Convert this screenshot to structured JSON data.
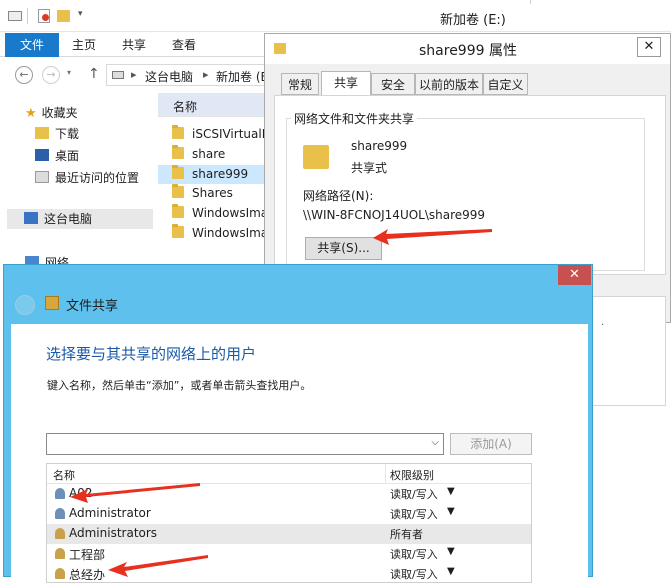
{
  "explorer": {
    "window_title": "新加卷 (E:)",
    "ribbon_tabs": [
      "文件",
      "主页",
      "共享",
      "查看"
    ],
    "breadcrumb": [
      "这台电脑",
      "新加卷 (E"
    ],
    "nav": {
      "favorites": "收藏夹",
      "downloads": "下载",
      "desktop": "桌面",
      "recent": "最近访问的位置",
      "this_pc": "这台电脑",
      "network": "网络"
    },
    "column_name": "名称",
    "files": [
      "iSCSIVirtualD",
      "share",
      "share999",
      "Shares",
      "WindowsIma",
      "WindowsIma"
    ]
  },
  "properties": {
    "title": "share999 属性",
    "tabs": [
      "常规",
      "共享",
      "安全",
      "以前的版本",
      "自定义"
    ],
    "group_title": "网络文件和文件夹共享",
    "folder_name": "share999",
    "folder_state": "共享式",
    "path_label": "网络路径(N):",
    "path_value": "\\\\WIN-8FCNOJ14UOL\\share999",
    "share_button": "共享(S)..."
  },
  "wizard": {
    "title": "文件共享",
    "heading": "选择要与其共享的网络上的用户",
    "instruction": "键入名称，然后单击“添加”，或者单击箭头查找用户。",
    "input_value": "",
    "add_button": "添加(A)",
    "col_name": "名称",
    "col_level": "权限级别",
    "users": [
      {
        "name": "A02",
        "level": "读取/写入",
        "dropdown": true
      },
      {
        "name": "Administrator",
        "level": "读取/写入",
        "dropdown": true
      },
      {
        "name": "Administrators",
        "level": "所有者",
        "dropdown": false
      },
      {
        "name": "工程部",
        "level": "读取/写入",
        "dropdown": true
      },
      {
        "name": "总经办",
        "level": "读取/写入",
        "dropdown": true
      }
    ]
  },
  "colors": {
    "ribbon_file_tab": "#1979ca",
    "wizard_frame": "#5ec0ec",
    "wizard_heading": "#1a5aa8",
    "close_button": "#c75050",
    "annotation_arrow": "#e8301f",
    "folder": "#e8c04a"
  },
  "icons": [
    "back-arrow-icon",
    "forward-arrow-icon",
    "up-arrow-icon",
    "folder-icon",
    "star-icon",
    "desktop-icon",
    "computer-icon",
    "user-icon",
    "group-icon",
    "share-wizard-icon",
    "close-icon",
    "chevron-down-icon"
  ]
}
